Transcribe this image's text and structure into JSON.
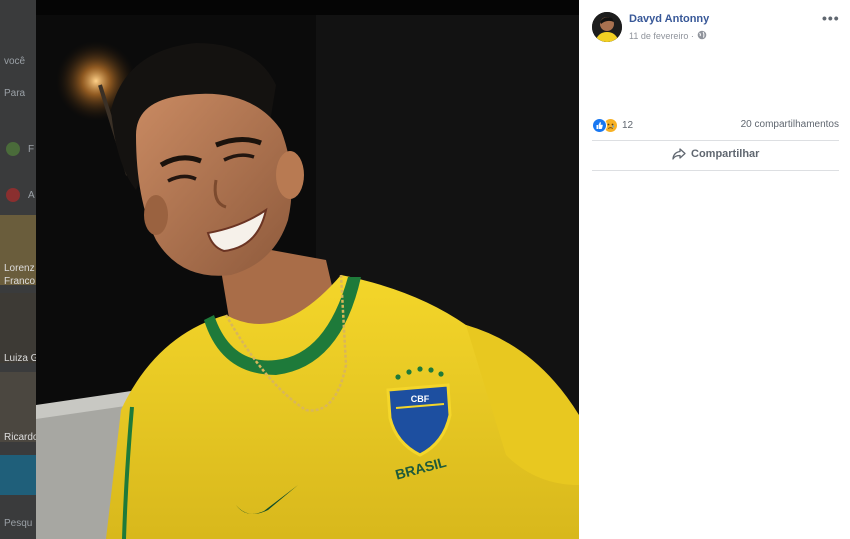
{
  "post": {
    "author": "Davyd Antonny",
    "date": "11 de fevereiro",
    "date_separator": "·",
    "privacy_icon": "globe-icon",
    "more_icon": "more-options-icon",
    "more_label": "•••",
    "reaction_count": "12",
    "reaction_types": [
      "like",
      "sad"
    ],
    "shares": "20 compartilhamentos",
    "share_label": "Compartilhar",
    "share_icon": "share-arrow-icon"
  },
  "photo": {
    "jersey_text": "BRASIL",
    "badge_text": "CBF"
  },
  "background": {
    "fragments": [
      "você",
      "Para",
      "F",
      "A",
      "Lorenz",
      "Franco",
      "Luiza G",
      "Ricardo",
      "Pesqu"
    ]
  },
  "colors": {
    "link": "#385898",
    "secondary_text": "#606770",
    "like_blue": "#1877f2",
    "sad_yellow": "#f7b125",
    "jersey_yellow": "#f2d023",
    "jersey_green": "#1e7a3a"
  }
}
